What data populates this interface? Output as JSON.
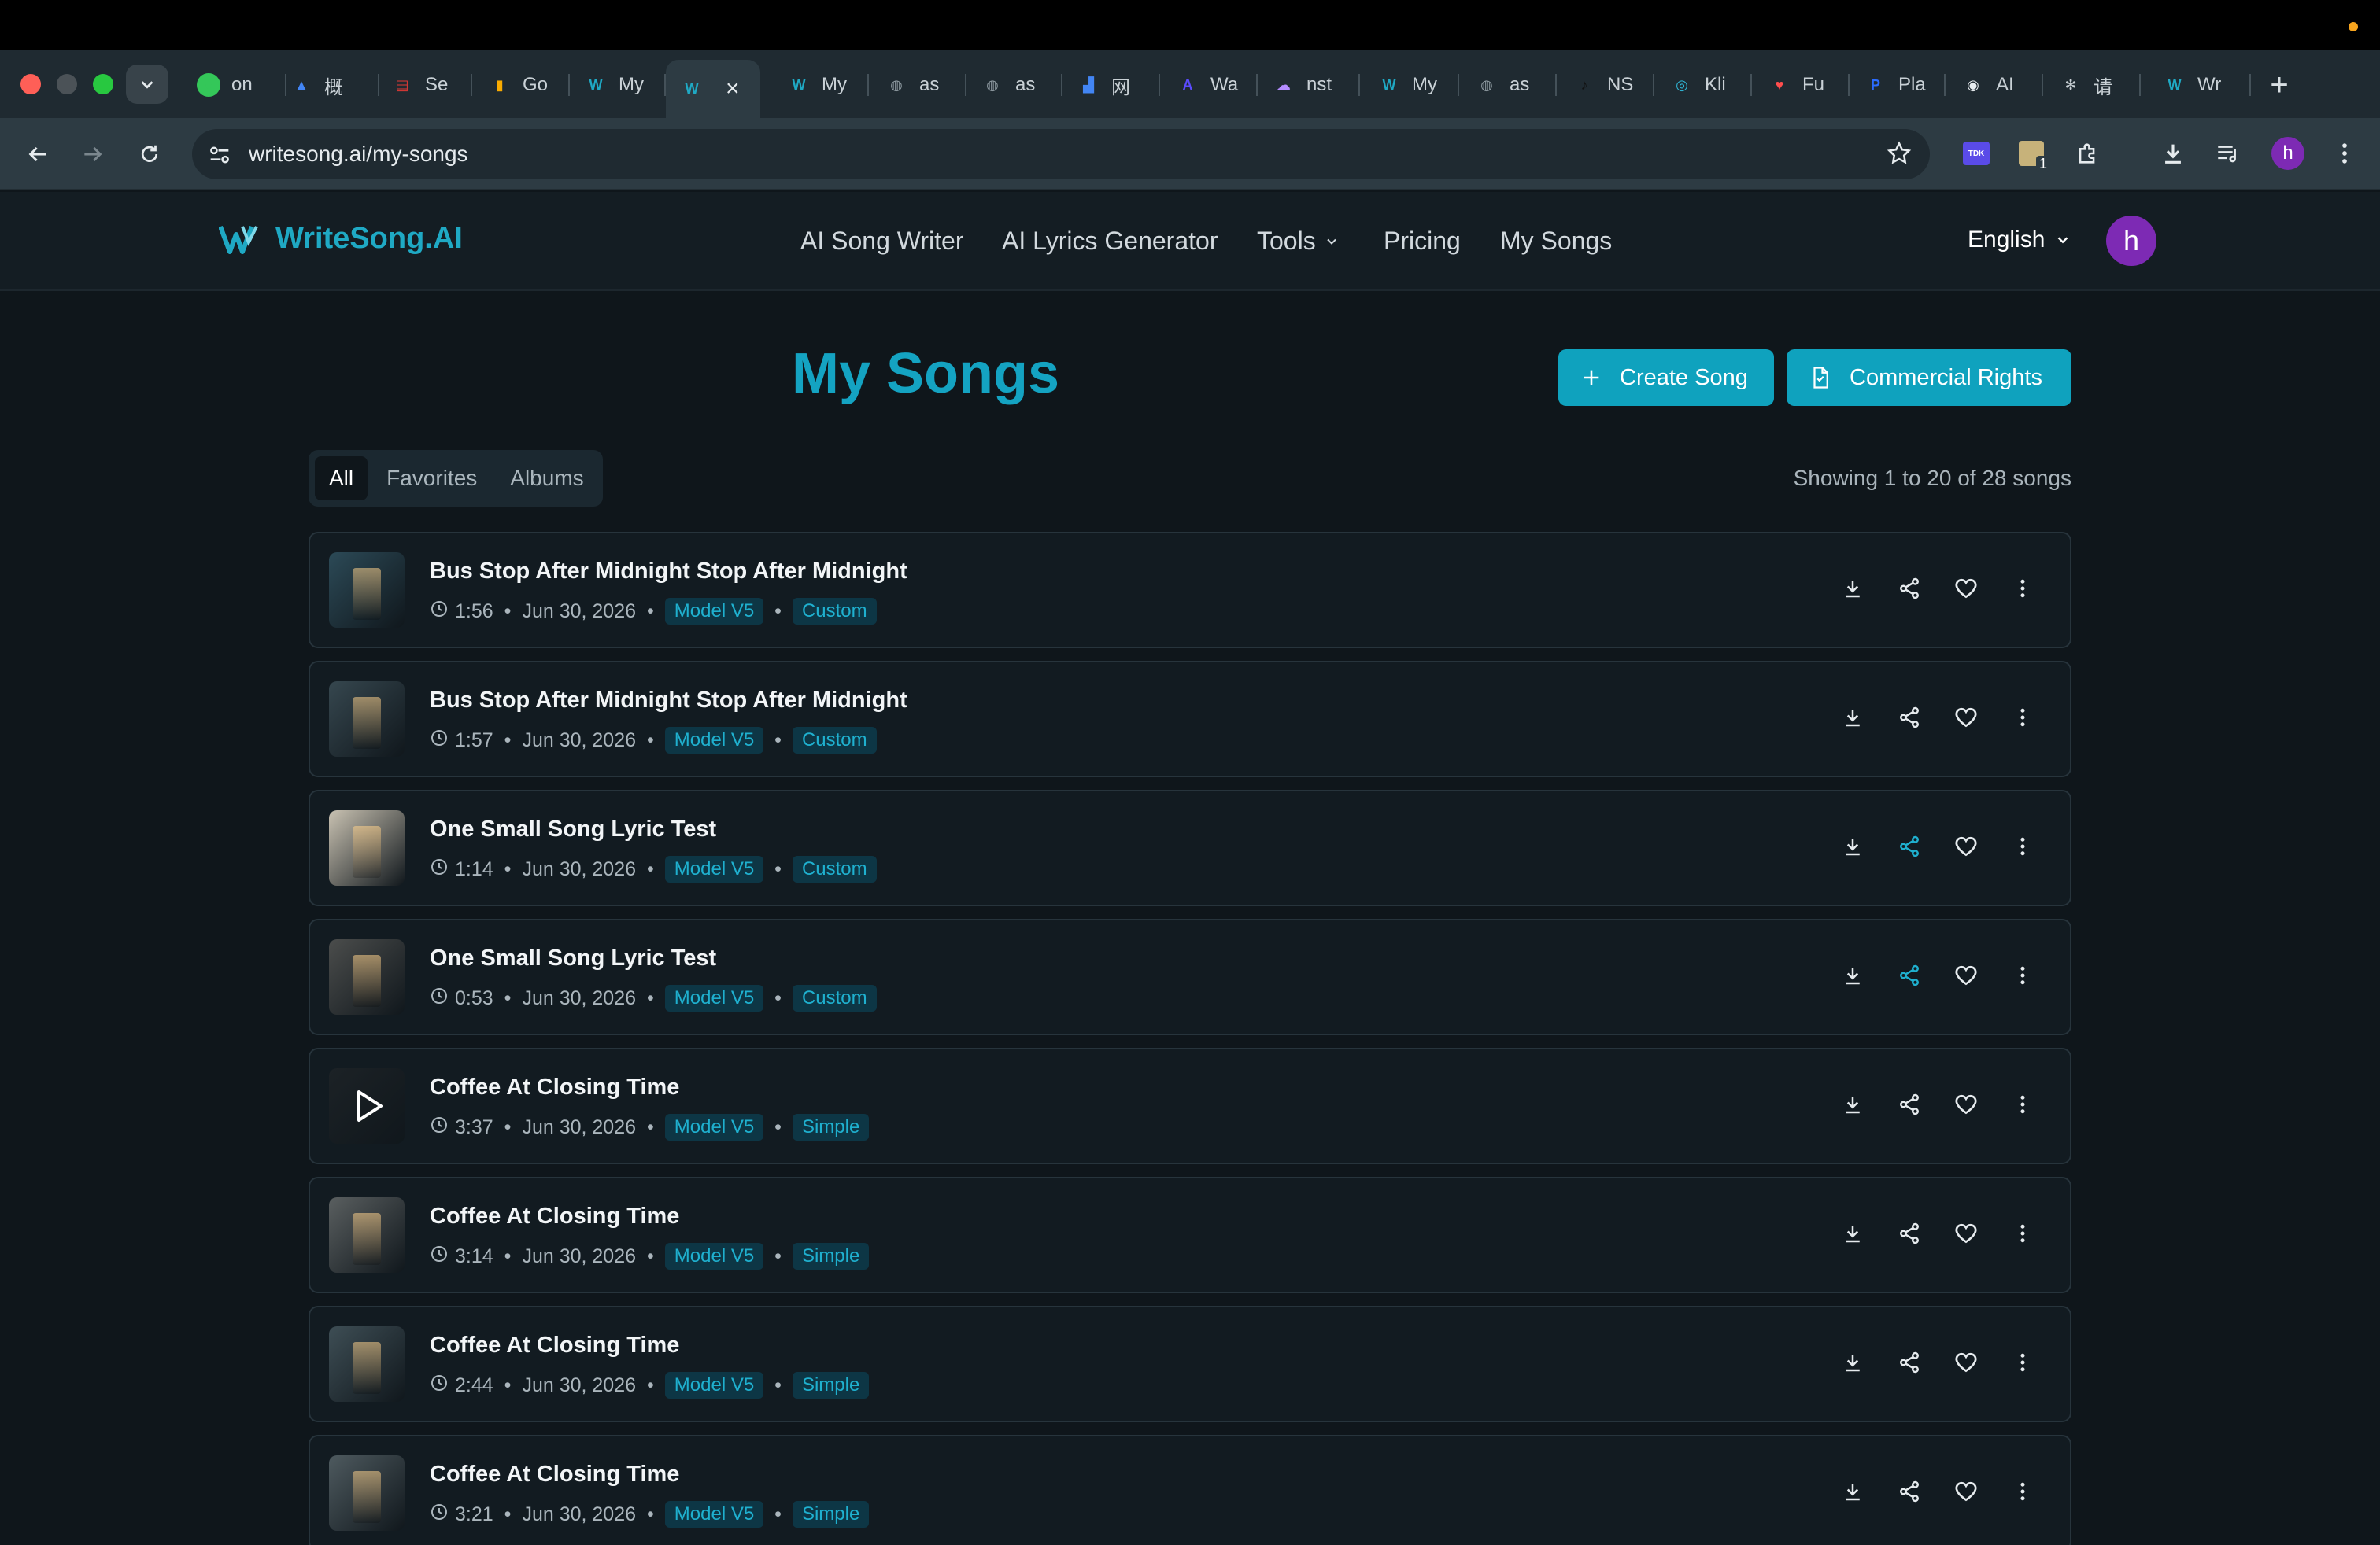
{
  "browser": {
    "tabs": [
      {
        "label": "on",
        "fav": "●",
        "fav_color": "#34c759"
      },
      {
        "label": "概",
        "fav": "▲",
        "fav_color": "#4285f4"
      },
      {
        "label": "Se",
        "fav": "▤",
        "fav_color": "#e53935"
      },
      {
        "label": "Go",
        "fav": "▮",
        "fav_color": "#f9ab00"
      },
      {
        "label": "My",
        "fav": "W",
        "fav_color": "#1fa9c4"
      },
      {
        "label": "",
        "fav": "W",
        "fav_color": "#1fa9c4"
      },
      {
        "label": "My",
        "fav": "W",
        "fav_color": "#1fa9c4"
      },
      {
        "label": "as",
        "fav": "◍",
        "fav_color": "#8e9aa1"
      },
      {
        "label": "as",
        "fav": "◍",
        "fav_color": "#8e9aa1"
      },
      {
        "label": "网",
        "fav": "▟",
        "fav_color": "#4285f4"
      },
      {
        "label": "Wa",
        "fav": "A",
        "fav_color": "#5b4bff"
      },
      {
        "label": "nst",
        "fav": "☁",
        "fav_color": "#b48cff"
      },
      {
        "label": "My",
        "fav": "W",
        "fav_color": "#1fa9c4"
      },
      {
        "label": "as",
        "fav": "◍",
        "fav_color": "#8e9aa1"
      },
      {
        "label": "NS",
        "fav": "♪",
        "fav_color": "#111111"
      },
      {
        "label": "Kli",
        "fav": "◎",
        "fav_color": "#2fb8d8"
      },
      {
        "label": "Fu",
        "fav": "♥",
        "fav_color": "#ff4d4d"
      },
      {
        "label": "Pla",
        "fav": "P",
        "fav_color": "#2b6cff"
      },
      {
        "label": "AI",
        "fav": "◉",
        "fav_color": "#e8edf0"
      },
      {
        "label": "请",
        "fav": "✻",
        "fav_color": "#c9d1d6"
      },
      {
        "label": "Wr",
        "fav": "W",
        "fav_color": "#1fa9c4"
      }
    ],
    "url": "writesong.ai/my-songs",
    "profile_initial": "h",
    "ext_badge": "1",
    "ext_tdk": "TDK"
  },
  "header": {
    "logo": "WriteSong.AI",
    "nav": [
      "AI Song Writer",
      "AI Lyrics Generator",
      "Tools",
      "Pricing",
      "My Songs"
    ],
    "language": "English",
    "avatar_initial": "h"
  },
  "page": {
    "title": "My Songs",
    "create_label": "Create Song",
    "rights_label": "Commercial Rights",
    "filters": [
      "All",
      "Favorites",
      "Albums"
    ],
    "active_filter": "All",
    "showing": "Showing 1 to 20 of 28 songs"
  },
  "songs": [
    {
      "title": "Bus Stop After Midnight Stop After Midnight",
      "duration": "1:56",
      "date": "Jun 30, 2026",
      "model": "Model V5",
      "mode": "Custom",
      "thumb": "#2c4a57",
      "shared": false
    },
    {
      "title": "Bus Stop After Midnight Stop After Midnight",
      "duration": "1:57",
      "date": "Jun 30, 2026",
      "model": "Model V5",
      "mode": "Custom",
      "thumb": "#36474f",
      "shared": false
    },
    {
      "title": "One Small Song Lyric Test",
      "duration": "1:14",
      "date": "Jun 30, 2026",
      "model": "Model V5",
      "mode": "Custom",
      "thumb": "#c9c2b2",
      "shared": true
    },
    {
      "title": "One Small Song Lyric Test",
      "duration": "0:53",
      "date": "Jun 30, 2026",
      "model": "Model V5",
      "mode": "Custom",
      "thumb": "#4b4d4c",
      "shared": true
    },
    {
      "title": "Coffee At Closing Time",
      "duration": "3:37",
      "date": "Jun 30, 2026",
      "model": "Model V5",
      "mode": "Simple",
      "thumb": "#1c2226",
      "shared": false,
      "play": true
    },
    {
      "title": "Coffee At Closing Time",
      "duration": "3:14",
      "date": "Jun 30, 2026",
      "model": "Model V5",
      "mode": "Simple",
      "thumb": "#5a5f60",
      "shared": false
    },
    {
      "title": "Coffee At Closing Time",
      "duration": "2:44",
      "date": "Jun 30, 2026",
      "model": "Model V5",
      "mode": "Simple",
      "thumb": "#3e4e55",
      "shared": false
    },
    {
      "title": "Coffee At Closing Time",
      "duration": "3:21",
      "date": "Jun 30, 2026",
      "model": "Model V5",
      "mode": "Simple",
      "thumb": "#4e5a5f",
      "shared": false
    }
  ],
  "colors": {
    "accent": "#14a3c2",
    "button": "#0fa2be",
    "pill_bg": "#0d3645",
    "background": "#0f161b"
  }
}
